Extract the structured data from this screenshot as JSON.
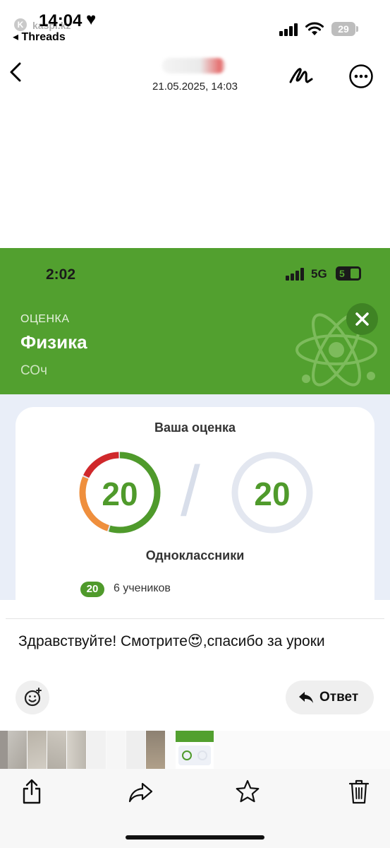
{
  "status_bar": {
    "time": "14:04",
    "back_app": "◂ Threads",
    "kaspi_logo_text": "kaspi.kz",
    "battery": "29"
  },
  "nav": {
    "date": "21.05.2025, 14:03"
  },
  "screenshot": {
    "status": {
      "time": "2:02",
      "network": "5G",
      "battery": "5"
    },
    "header": {
      "label": "ОЦЕНКА",
      "subject": "Физика",
      "type": "СОч"
    },
    "card": {
      "title": "Ваша оценка",
      "score": "20",
      "max_score": "20",
      "score_fraction": 1.0,
      "classmates_title": "Одноклассники",
      "classmates": [
        {
          "grade": "20",
          "count_text": "6 учеников"
        }
      ]
    },
    "colors": {
      "green": "#52a02f",
      "red": "#d0282b",
      "orange": "#ef8f3d"
    }
  },
  "message": {
    "text": "Здравствуйте! Смотрите😍,спасибо за уроки",
    "reply_label": "Ответ"
  },
  "icons": [
    "chevron-left-icon",
    "markup-icon",
    "more-icon",
    "smiley-add-icon",
    "reply-arrow-icon",
    "share-icon",
    "forward-icon",
    "star-icon",
    "trash-icon",
    "atom-icon",
    "close-icon"
  ]
}
